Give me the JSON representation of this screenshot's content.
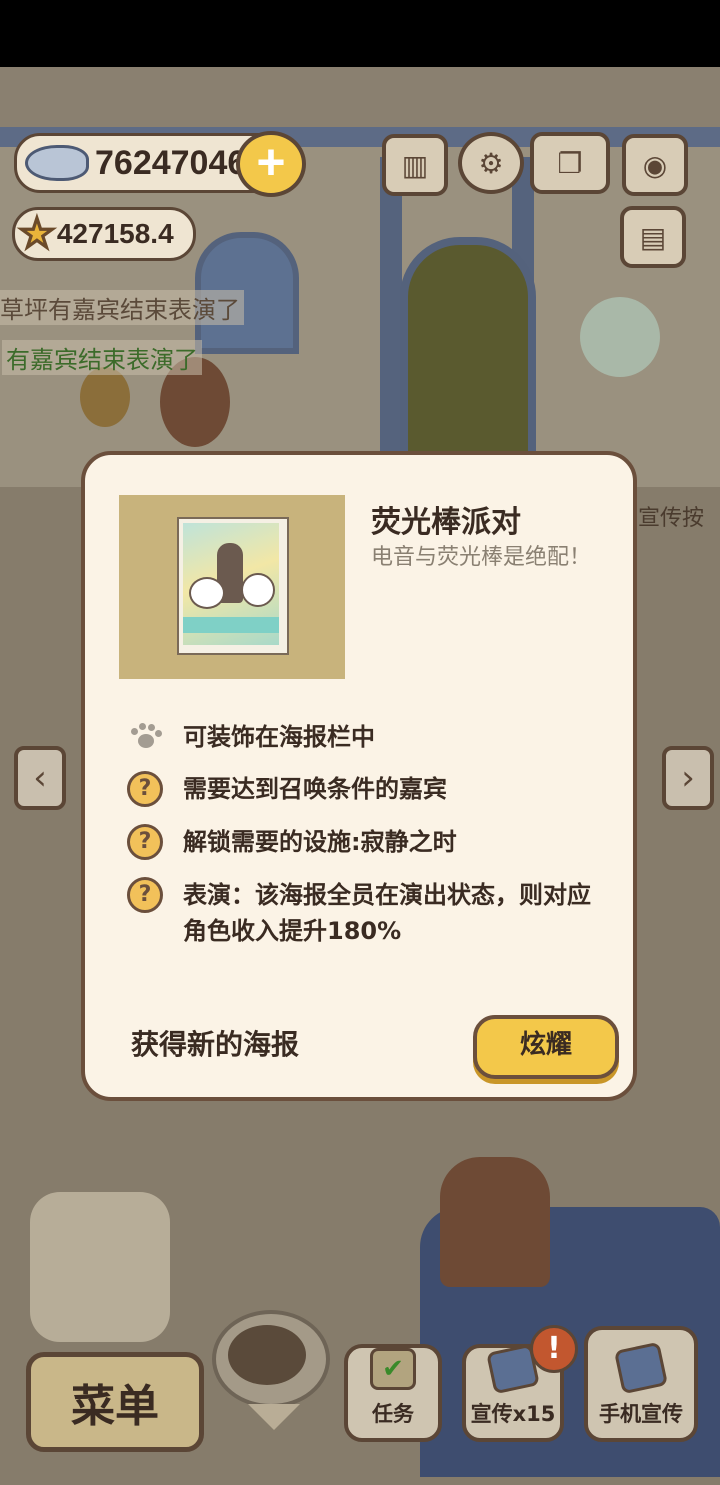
{
  "hud": {
    "fish_count": "76247046",
    "star_count": "427158.4",
    "plus_label": "+"
  },
  "top_icons": [
    "ranking-icon",
    "settings-gear-icon",
    "paw-book-icon",
    "camera-icon",
    "poster-board-icon"
  ],
  "feed": {
    "msg1": "草坪有嘉宾结束表演了",
    "msg2": "有嘉宾结束表演了",
    "background_promo": "宣传按"
  },
  "modal": {
    "poster_title": "荧光棒派对",
    "poster_desc": "电音与荧光棒是绝配！",
    "features": [
      {
        "icon": "paw-icon",
        "text": "可装饰在海报栏中"
      },
      {
        "icon": "question-icon",
        "text": "需要达到召唤条件的嘉宾"
      },
      {
        "icon": "question-icon",
        "text": "解锁需要的设施:寂静之时"
      },
      {
        "icon": "question-icon",
        "text": "表演：该海报全员在演出状态，则对应角色收入提升180%"
      }
    ],
    "question_mark": "?",
    "obtain_label": "获得新的海报",
    "show_button": "炫耀"
  },
  "arrows": {
    "left": "‹",
    "right": "›"
  },
  "bottom_bar": {
    "menu": "菜单",
    "tasks": "任务",
    "promo": "宣传x15",
    "phone_promo": "手机宣传",
    "alert": "!"
  },
  "colors": {
    "accent_yellow": "#f3c84a",
    "outline_brown": "#6b4f3c",
    "modal_bg": "#fbf3e6",
    "question_badge": "#f2c15a"
  }
}
